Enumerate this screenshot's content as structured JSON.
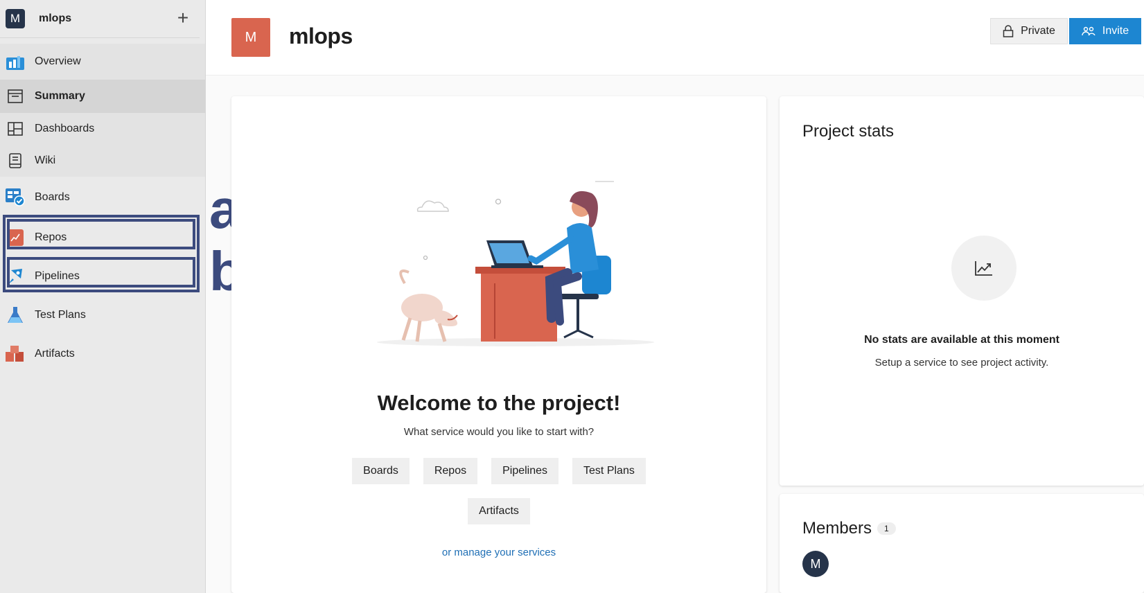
{
  "project": {
    "initial": "M",
    "name": "mlops"
  },
  "sidebar": {
    "add_label": "+",
    "items": [
      {
        "label": "Overview",
        "icon": "overview-icon"
      },
      {
        "label": "Summary",
        "icon": "summary-icon"
      },
      {
        "label": "Dashboards",
        "icon": "dashboards-icon"
      },
      {
        "label": "Wiki",
        "icon": "wiki-icon"
      },
      {
        "label": "Boards",
        "icon": "boards-icon"
      },
      {
        "label": "Repos",
        "icon": "repos-icon"
      },
      {
        "label": "Pipelines",
        "icon": "pipelines-icon"
      },
      {
        "label": "Test Plans",
        "icon": "test-plans-icon"
      },
      {
        "label": "Artifacts",
        "icon": "artifacts-icon"
      }
    ]
  },
  "annotations": {
    "a": "a",
    "b": "b"
  },
  "header": {
    "title": "mlops",
    "avatar_initial": "M",
    "private_label": "Private",
    "invite_label": "Invite"
  },
  "welcome": {
    "title": "Welcome to the project!",
    "subtitle": "What service would you like to start with?",
    "services": [
      "Boards",
      "Repos",
      "Pipelines",
      "Test Plans",
      "Artifacts"
    ],
    "manage_link": "or manage your services"
  },
  "stats": {
    "title": "Project stats",
    "empty_title": "No stats are available at this moment",
    "empty_sub": "Setup a service to see project activity."
  },
  "members": {
    "title": "Members",
    "count": "1",
    "avatar_initial": "M"
  },
  "colors": {
    "accent": "#1d86d1",
    "project": "#d9654f",
    "annotation": "#3c4b7e"
  }
}
